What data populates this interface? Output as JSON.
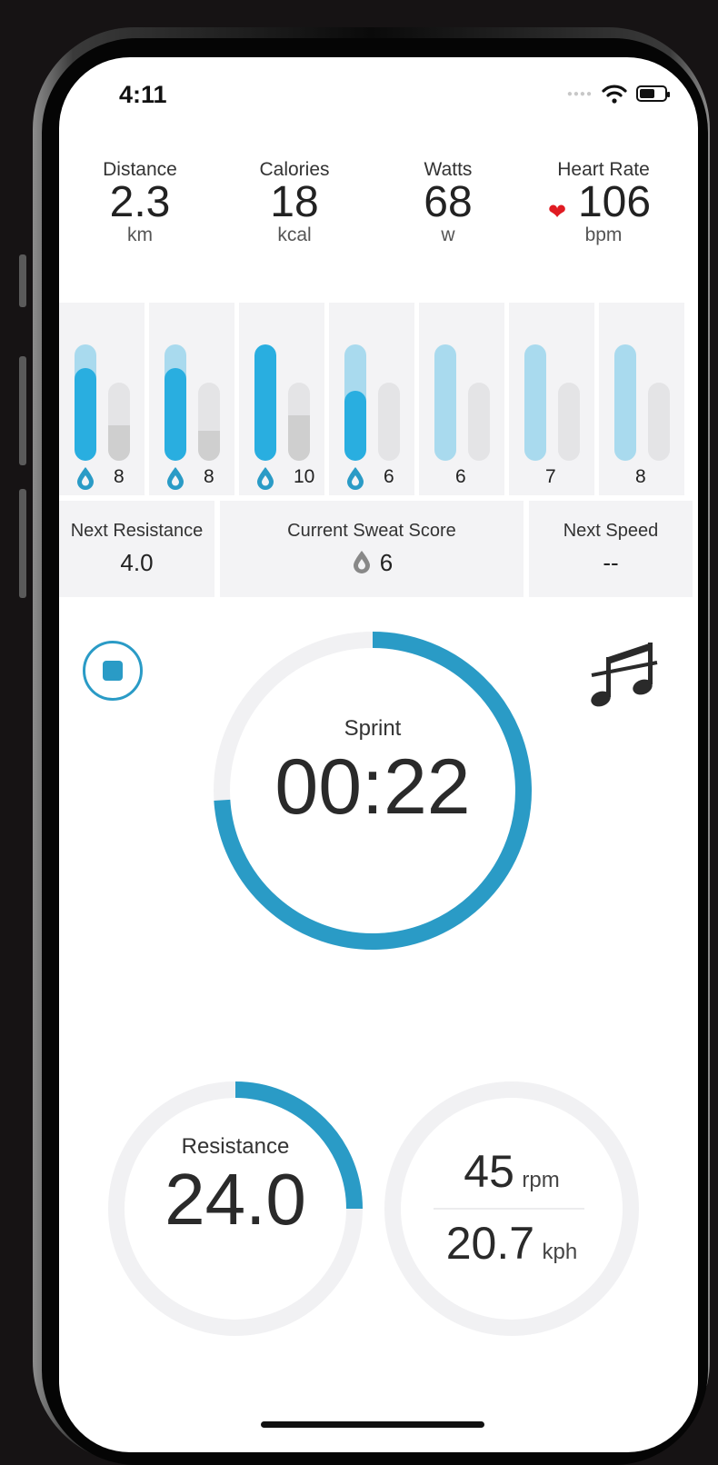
{
  "status_bar": {
    "time": "4:11"
  },
  "stats": [
    {
      "label": "Distance",
      "value": "2.3",
      "unit": "km"
    },
    {
      "label": "Calories",
      "value": "18",
      "unit": "kcal"
    },
    {
      "label": "Watts",
      "value": "68",
      "unit": "w"
    },
    {
      "label": "Heart Rate",
      "value": "106",
      "unit": "bpm"
    }
  ],
  "sweat_bars": [
    {
      "score": "8",
      "fill": 0.8,
      "side_fill": 0.45,
      "drop": true
    },
    {
      "score": "8",
      "fill": 0.8,
      "side_fill": 0.38,
      "drop": true
    },
    {
      "score": "10",
      "fill": 1.0,
      "side_fill": 0.58,
      "drop": true
    },
    {
      "score": "6",
      "fill": 0.6,
      "side_fill": 0.0,
      "drop": true
    },
    {
      "score": "6",
      "fill": 0.0,
      "side_fill": 0.0,
      "drop": false
    },
    {
      "score": "7",
      "fill": 0.0,
      "side_fill": 0.0,
      "drop": false
    },
    {
      "score": "8",
      "fill": 0.0,
      "side_fill": 0.0,
      "drop": false
    }
  ],
  "next_resistance": {
    "label": "Next Resistance",
    "value": "4.0"
  },
  "current_sweat_score": {
    "label": "Current Sweat Score",
    "value": "6"
  },
  "next_speed": {
    "label": "Next Speed",
    "value": "--"
  },
  "timer": {
    "label": "Sprint",
    "time": "00:22",
    "progress": 0.74
  },
  "resistance": {
    "label": "Resistance",
    "value": "24.0",
    "progress": 0.25
  },
  "cadence": {
    "rpm": "45",
    "rpm_unit": "rpm",
    "speed": "20.7",
    "speed_unit": "kph"
  },
  "icons": [
    "stop-icon",
    "music-icon",
    "water-drop-icon",
    "heart-icon",
    "wifi-icon",
    "battery-icon"
  ],
  "colors": {
    "accent": "#2a9bc6",
    "bar_active": "#29aee0",
    "bar_inactive": "#a9daee",
    "heart": "#e01b22"
  }
}
